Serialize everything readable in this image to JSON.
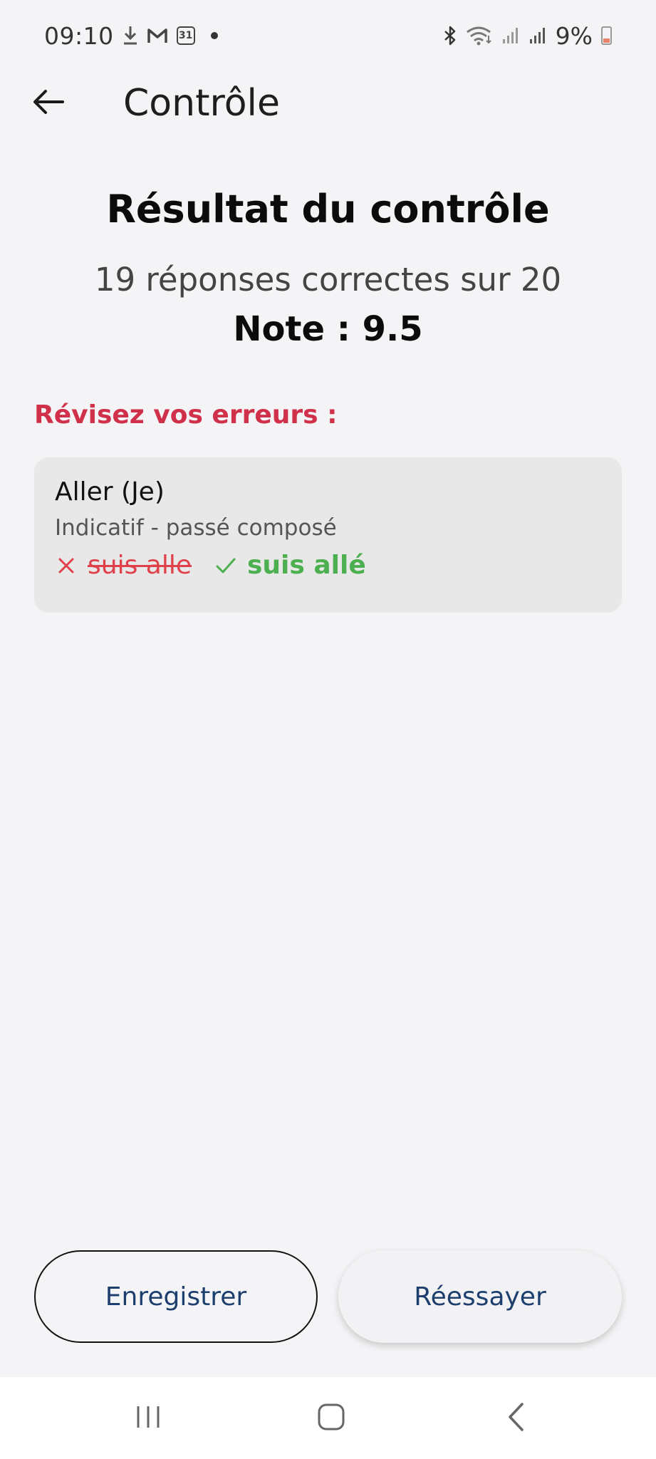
{
  "status_bar": {
    "time": "09:10",
    "calendar_day": "31",
    "battery": "9%",
    "icons": [
      "download-icon",
      "gmail-icon",
      "calendar-icon",
      "dot-icon",
      "bluetooth-icon",
      "wifi-icon",
      "signal-icon",
      "signal-icon",
      "battery-icon"
    ]
  },
  "app_bar": {
    "back_icon": "arrow-left-icon",
    "title": "Contrôle"
  },
  "result": {
    "title": "Résultat du contrôle",
    "summary": "19 réponses correctes sur 20",
    "note": "Note : 9.5"
  },
  "errors": {
    "heading": "Révisez vos erreurs :",
    "items": [
      {
        "verb": "Aller (Je)",
        "tense": "Indicatif - passé composé",
        "wrong_answer": "suis alle",
        "correct_answer": "suis allé"
      }
    ]
  },
  "actions": {
    "save_label": "Enregistrer",
    "retry_label": "Réessayer"
  },
  "nav_bar": {
    "icons": [
      "recent-apps-icon",
      "home-icon",
      "back-icon"
    ]
  },
  "colors": {
    "background": "#f4f4f6",
    "error_heading": "#d0304a",
    "wrong": "#e0404a",
    "correct": "#4caf50",
    "button_text": "#1d3f6e"
  }
}
